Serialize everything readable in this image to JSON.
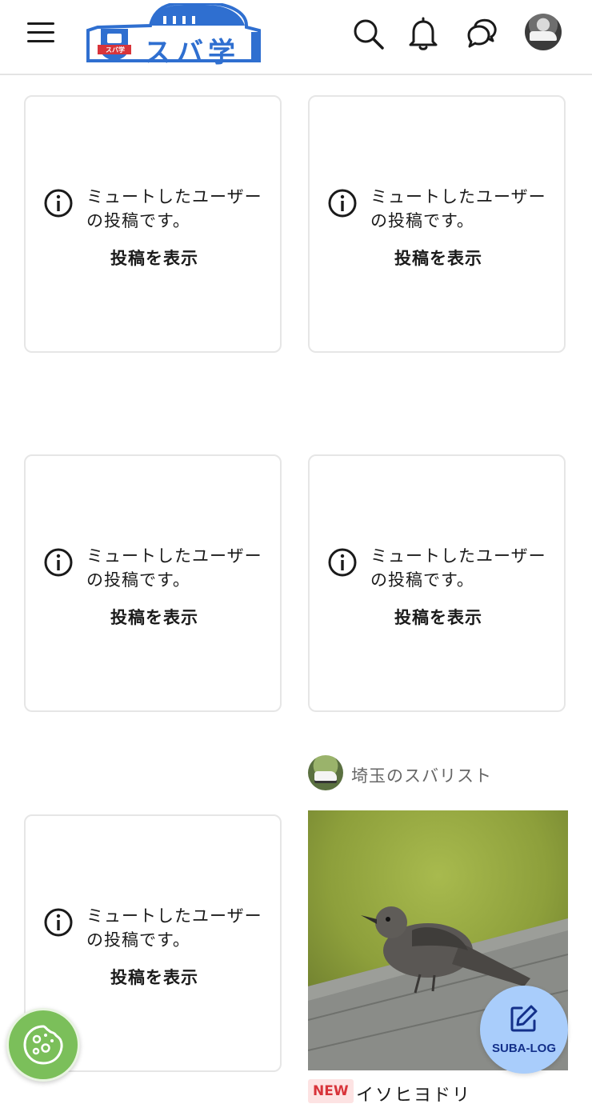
{
  "header": {
    "logo_text": "スバ学",
    "logo_badge": "スバ学"
  },
  "muted_cards": [
    {
      "message": "ミュートしたユーザーの投稿です。",
      "action": "投稿を表示"
    },
    {
      "message": "ミュートしたユーザーの投稿です。",
      "action": "投稿を表示"
    },
    {
      "message": "ミュートしたユーザーの投稿です。",
      "action": "投稿を表示"
    },
    {
      "message": "ミュートしたユーザーの投稿です。",
      "action": "投稿を表示"
    },
    {
      "message": "ミュートしたユーザーの投稿です。",
      "action": "投稿を表示"
    }
  ],
  "post": {
    "username": "埼玉のスバリスト",
    "badge": "NEW",
    "title": "イソヒヨドリ"
  },
  "fab": {
    "label": "SUBA-LOG"
  },
  "colors": {
    "brand": "#2f6fd0",
    "fab_bg": "#a9cdfb",
    "fab_text": "#13308a",
    "cookie_bg": "#7bbf5a",
    "new_badge_text": "#d8343a",
    "new_badge_bg": "#fde3e3"
  },
  "icons": {
    "menu": "hamburger-icon",
    "search": "search-icon",
    "notifications": "bell-icon",
    "messages": "chat-bubbles-icon",
    "info": "info-circle-icon",
    "edit": "edit-icon",
    "cookie": "cookie-icon"
  }
}
